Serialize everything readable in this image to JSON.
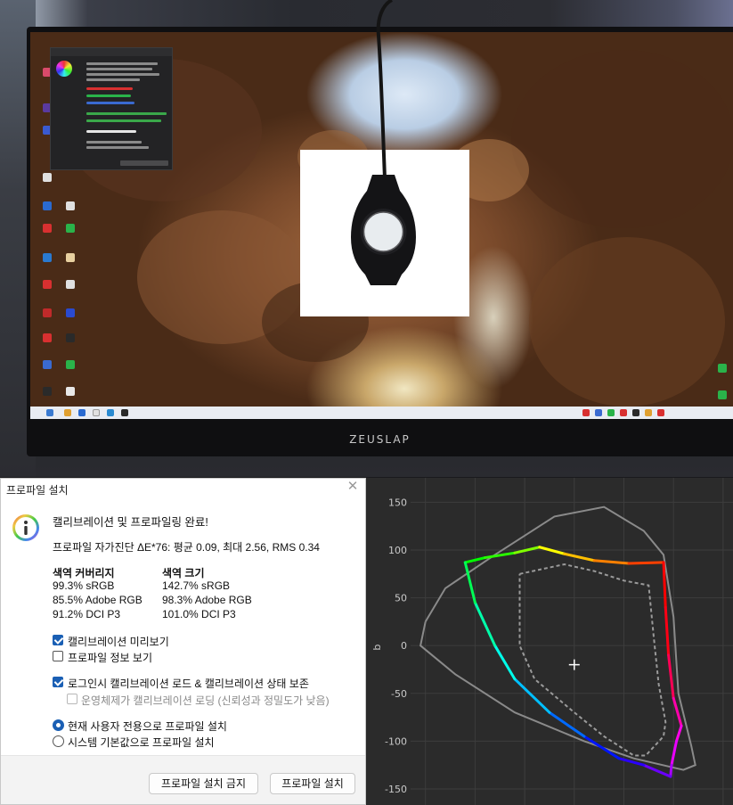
{
  "monitor": {
    "brand": "ZEUSLAP"
  },
  "dialog": {
    "title": "프로파일 설치",
    "headline": "캘리브레이션 및 프로파일링 완료!",
    "self_check": "프로파일 자가진단 ΔE*76: 평균 0.09, 최대 2.56, RMS 0.34",
    "coverage": {
      "header": "색역 커버리지",
      "rows": [
        "99.3% sRGB",
        "85.5% Adobe RGB",
        "91.2% DCI P3"
      ]
    },
    "volume": {
      "header": "색역 크기",
      "rows": [
        "142.7% sRGB",
        "98.3% Adobe RGB",
        "101.0% DCI P3"
      ]
    },
    "options": {
      "preview": {
        "label": "캘리브레이션 미리보기",
        "checked": true
      },
      "profile_info": {
        "label": "프로파일 정보 보기",
        "checked": false
      },
      "load_on_login": {
        "label": "로그인시 캘리브레이션 로드 & 캘리브레이션 상태 보존",
        "checked": true
      },
      "os_loading": {
        "label": "운영체제가 캘리브레이션 로딩 (신뢰성과 정밀도가 낮음)",
        "checked": false,
        "disabled": true
      }
    },
    "install_scope": {
      "current_user": {
        "label": "현재 사용자 전용으로 프로파일 설치",
        "selected": true
      },
      "system_default": {
        "label": "시스템 기본값으로 프로파일 설치",
        "selected": false
      }
    },
    "buttons": {
      "cancel": "프로파일 설치 금지",
      "install": "프로파일 설치"
    }
  },
  "chart_data": {
    "type": "scatter",
    "xlabel": "",
    "ylabel": "b",
    "yticks": [
      150,
      100,
      50,
      0,
      -50,
      -100,
      -150
    ],
    "ylim": [
      -150,
      155
    ],
    "grid": true,
    "whitepoint": [
      0,
      -20
    ],
    "series": [
      {
        "style": "colored-solid",
        "points": [
          [
            -110,
            87
          ],
          [
            -90,
            92
          ],
          [
            -60,
            97
          ],
          [
            -35,
            103
          ],
          [
            -10,
            96
          ],
          [
            20,
            89
          ],
          [
            55,
            86
          ],
          [
            90,
            87
          ],
          [
            92,
            40
          ],
          [
            95,
            -10
          ],
          [
            100,
            -55
          ],
          [
            108,
            -84
          ],
          [
            103,
            -100
          ],
          [
            98,
            -125
          ],
          [
            97,
            -137
          ],
          [
            70,
            -125
          ],
          [
            45,
            -118
          ],
          [
            10,
            -95
          ],
          [
            -25,
            -70
          ],
          [
            -60,
            -35
          ],
          [
            -80,
            0
          ],
          [
            -100,
            45
          ],
          [
            -110,
            87
          ]
        ]
      },
      {
        "style": "gray-solid",
        "points": [
          [
            -150,
            25
          ],
          [
            -130,
            60
          ],
          [
            -80,
            95
          ],
          [
            -20,
            135
          ],
          [
            30,
            145
          ],
          [
            70,
            120
          ],
          [
            90,
            95
          ],
          [
            100,
            30
          ],
          [
            105,
            -50
          ],
          [
            118,
            -105
          ],
          [
            122,
            -125
          ],
          [
            110,
            -130
          ],
          [
            60,
            -118
          ],
          [
            10,
            -100
          ],
          [
            -60,
            -70
          ],
          [
            -120,
            -30
          ],
          [
            -155,
            0
          ],
          [
            -150,
            25
          ]
        ]
      },
      {
        "style": "gray-dashed",
        "points": [
          [
            -55,
            75
          ],
          [
            -10,
            85
          ],
          [
            20,
            78
          ],
          [
            50,
            68
          ],
          [
            75,
            63
          ],
          [
            80,
            10
          ],
          [
            85,
            -40
          ],
          [
            92,
            -80
          ],
          [
            90,
            -95
          ],
          [
            72,
            -115
          ],
          [
            60,
            -115
          ],
          [
            30,
            -95
          ],
          [
            0,
            -70
          ],
          [
            -40,
            -35
          ],
          [
            -55,
            0
          ],
          [
            -55,
            75
          ]
        ]
      }
    ]
  }
}
